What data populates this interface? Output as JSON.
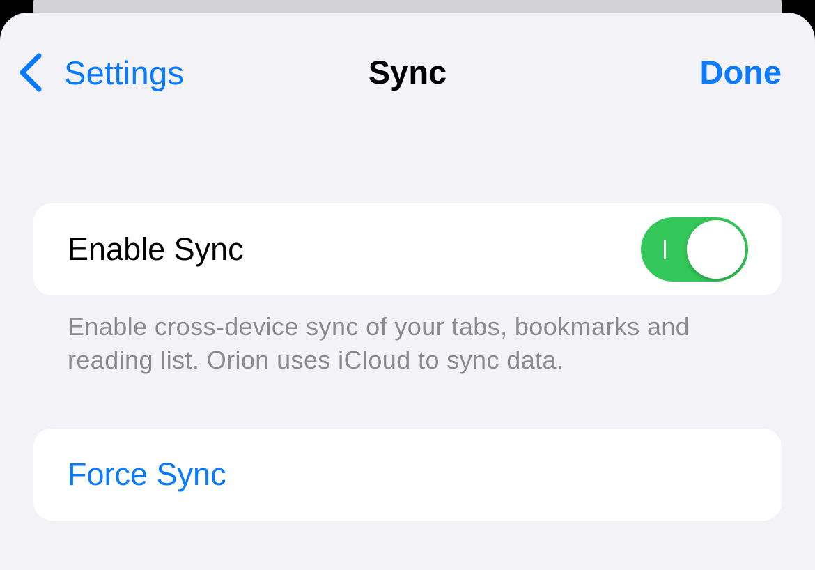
{
  "nav": {
    "back_label": "Settings",
    "title": "Sync",
    "done_label": "Done"
  },
  "sync_group": {
    "enable_label": "Enable Sync",
    "enable_state": true,
    "footer": "Enable cross-device sync of your tabs, bookmarks and reading list. Orion uses iCloud to sync data."
  },
  "actions": {
    "force_sync_label": "Force Sync"
  },
  "icons": {
    "back": "chevron-left-icon"
  },
  "colors": {
    "accent": "#0a7aff",
    "toggle_on": "#34c759",
    "background": "#f2f2f7",
    "footer_text": "#8a8a8e"
  }
}
